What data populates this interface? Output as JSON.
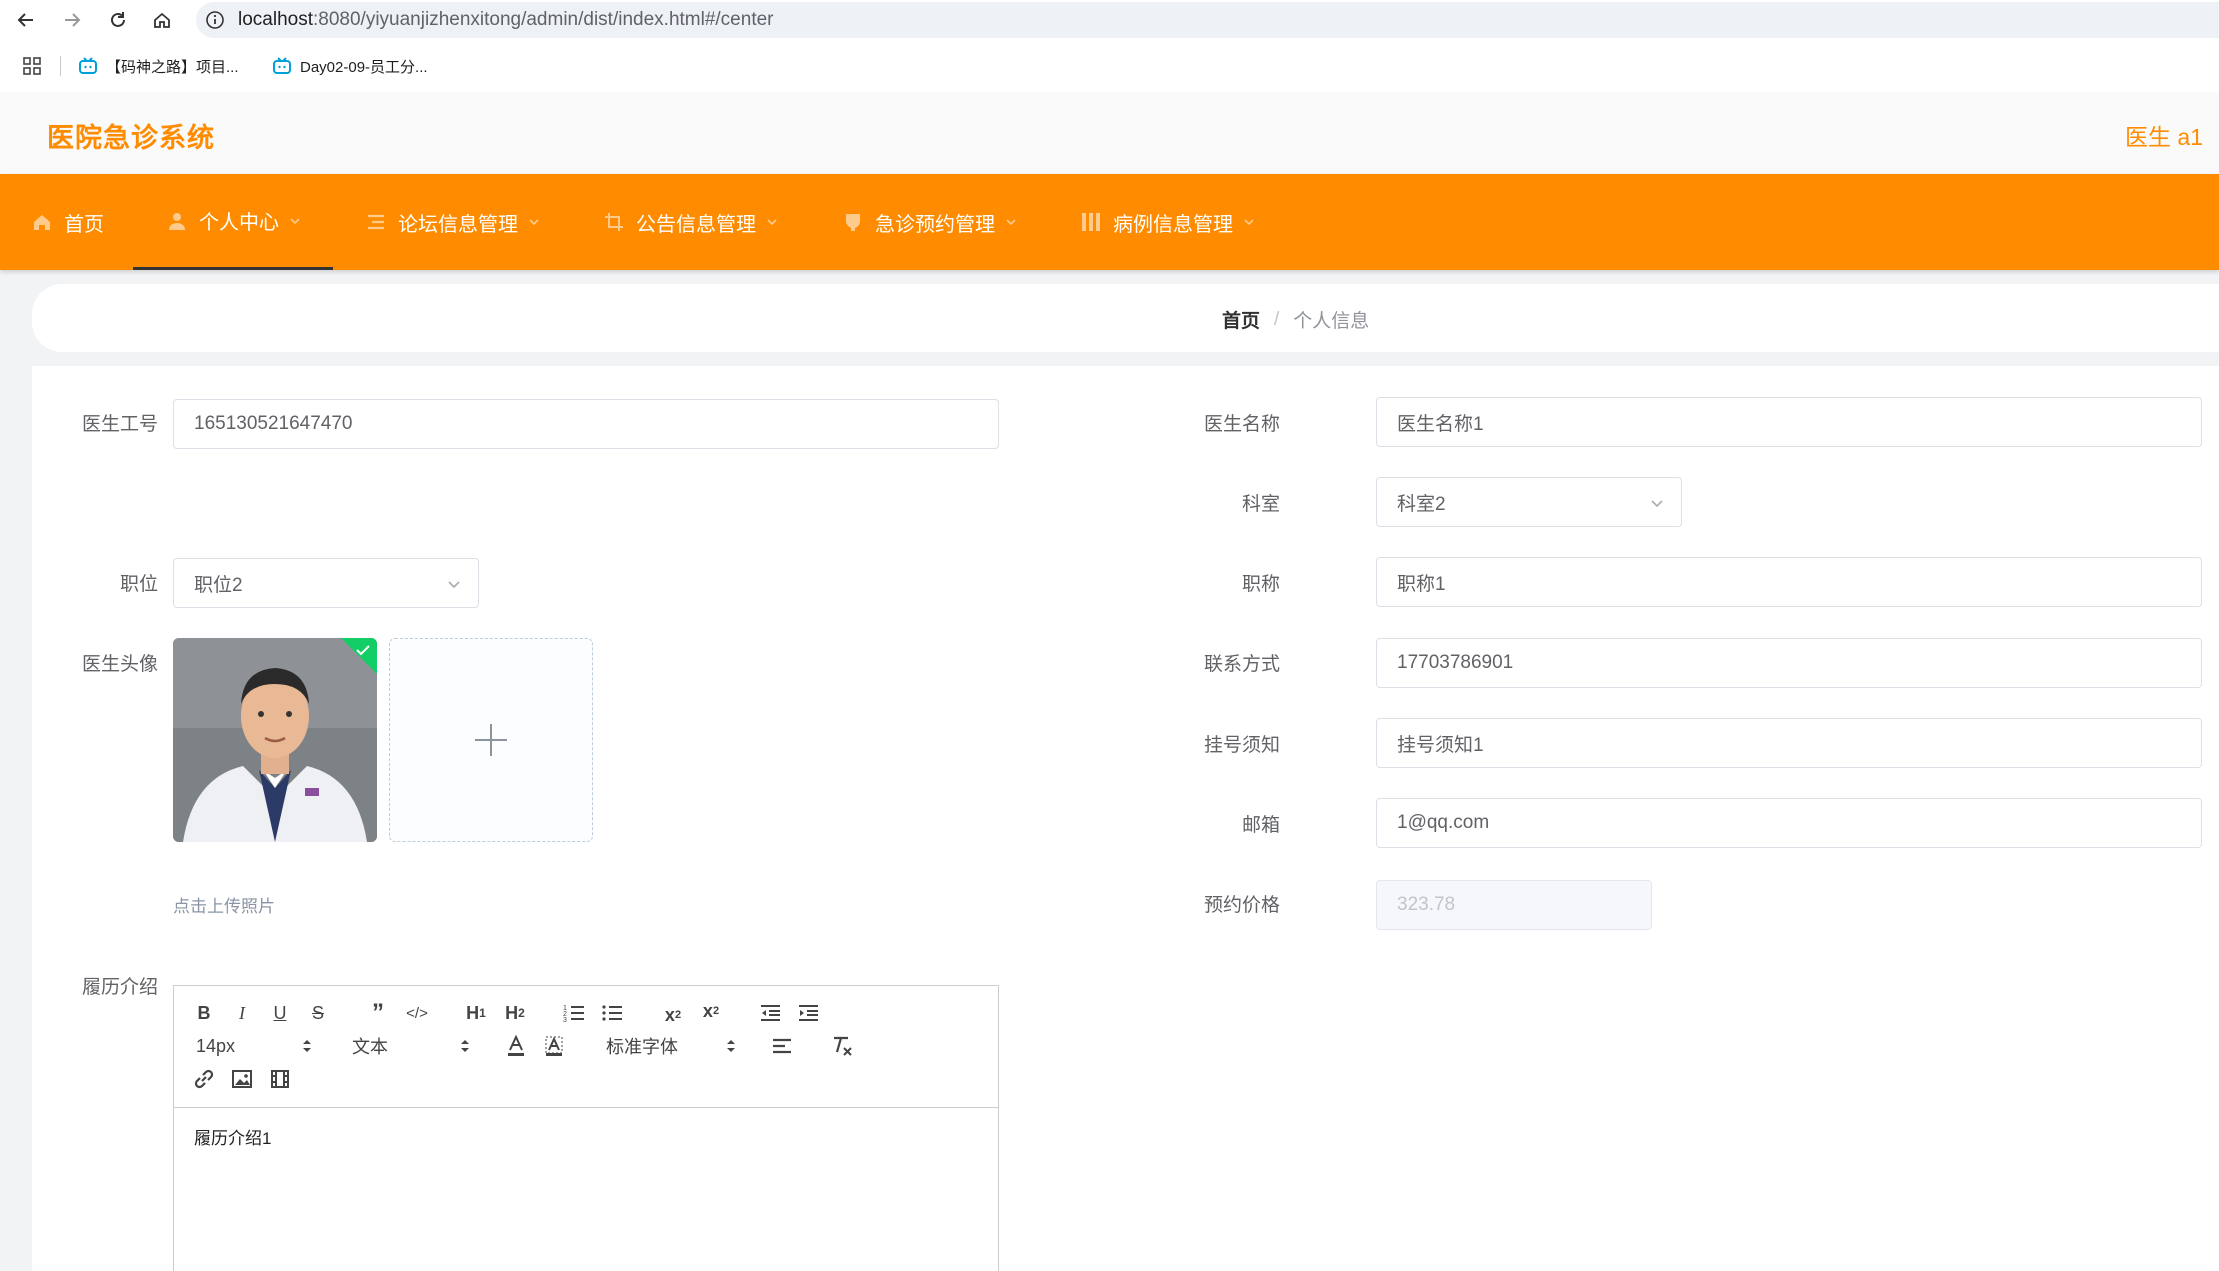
{
  "browser": {
    "url_host": "localhost",
    "url_path": ":8080/yiyuanjizhenxitong/admin/dist/index.html#/center",
    "bookmarks": [
      {
        "label": "【码神之路】项目..."
      },
      {
        "label": "Day02-09-员工分..."
      }
    ]
  },
  "header": {
    "app_title": "医院急诊系统",
    "user": "医生 a1"
  },
  "menu": {
    "items": [
      {
        "label": "首页",
        "icon": "home-icon"
      },
      {
        "label": "个人中心",
        "icon": "user-icon"
      },
      {
        "label": "论坛信息管理",
        "icon": "list-icon"
      },
      {
        "label": "公告信息管理",
        "icon": "crop-icon"
      },
      {
        "label": "急诊预约管理",
        "icon": "cup-icon"
      },
      {
        "label": "病例信息管理",
        "icon": "grid-icon"
      }
    ],
    "active_index": 1
  },
  "breadcrumb": {
    "home": "首页",
    "separator": "/",
    "current": "个人信息"
  },
  "form": {
    "doctor_id": {
      "label": "医生工号",
      "value": "165130521647470"
    },
    "doctor_name": {
      "label": "医生名称",
      "value": "医生名称1"
    },
    "department": {
      "label": "科室",
      "value": "科室2"
    },
    "position": {
      "label": "职位",
      "value": "职位2"
    },
    "title": {
      "label": "职称",
      "value": "职称1"
    },
    "avatar": {
      "label": "医生头像",
      "hint": "点击上传照片"
    },
    "phone": {
      "label": "联系方式",
      "value": "17703786901"
    },
    "notice": {
      "label": "挂号须知",
      "value": "挂号须知1"
    },
    "email": {
      "label": "邮箱",
      "value": "1@qq.com"
    },
    "price": {
      "label": "预约价格",
      "value": "323.78"
    },
    "resume": {
      "label": "履历介绍",
      "content": "履历介绍1"
    }
  },
  "editor_toolbar": {
    "font_size": "14px",
    "header_select": "文本",
    "font_family": "标准字体"
  },
  "colors": {
    "accent": "#ff8c00",
    "menu_bg": "#ff8c00",
    "success": "#13ce66"
  }
}
